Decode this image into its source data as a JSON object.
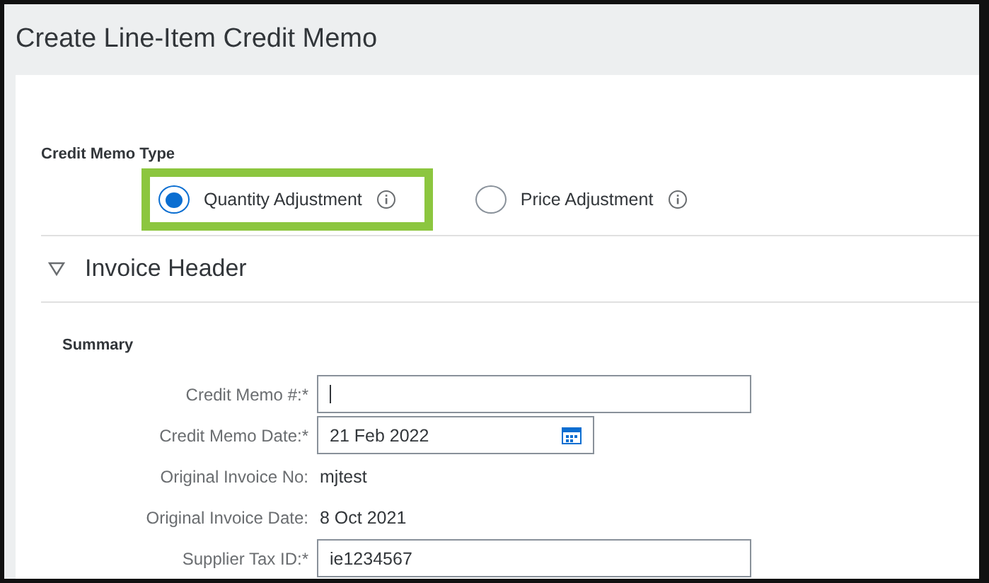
{
  "window": {
    "title": "Create Line-Item Credit Memo"
  },
  "credit_memo_type": {
    "label": "Credit Memo Type",
    "options": [
      {
        "label": "Quantity Adjustment",
        "selected": true,
        "highlighted": true
      },
      {
        "label": "Price Adjustment",
        "selected": false,
        "highlighted": false
      }
    ]
  },
  "section": {
    "title": "Invoice Header",
    "expanded": true
  },
  "summary": {
    "title": "Summary",
    "fields": [
      {
        "kind": "input",
        "label": "Credit Memo #:*",
        "focused": true
      },
      {
        "kind": "date",
        "label": "Credit Memo Date:*",
        "value": "21 Feb 2022"
      },
      {
        "kind": "text",
        "label": "Original Invoice No:",
        "value": "mjtest"
      },
      {
        "kind": "text",
        "label": "Original Invoice Date:",
        "value": "8 Oct 2021"
      },
      {
        "kind": "input",
        "label": "Supplier Tax ID:*",
        "value": "ie1234567"
      }
    ]
  }
}
